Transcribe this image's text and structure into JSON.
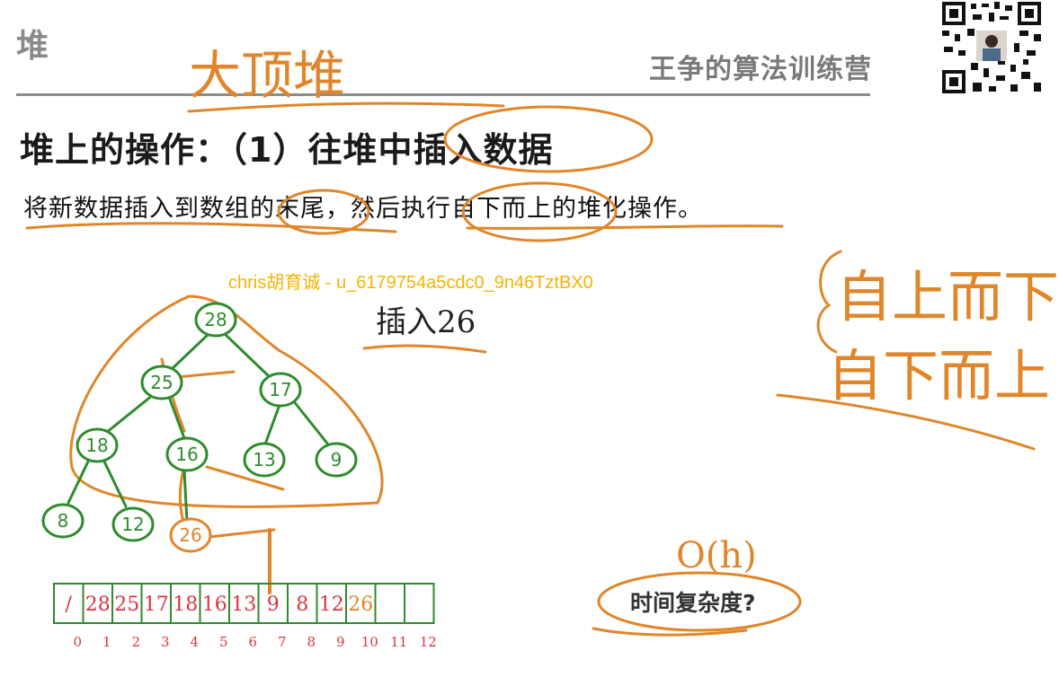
{
  "slide": {
    "corner_title": "堆",
    "brand": "王争的算法训练营",
    "heading": "堆上的操作：（1）往堆中插入数据",
    "description": "将新数据插入到数组的末尾，然后执行自下而上的堆化操作。",
    "watermark_user": "chris胡育诚 - u_6179754a5cdc0_9n46TztBX0",
    "bottom_question": "时间复杂度?"
  },
  "handwriting": {
    "top_note": "大顶堆",
    "insert_note": "插入26",
    "right_note_1": "自上而下",
    "right_note_2": "自下而上",
    "complexity_note": "O(h)"
  },
  "tree_nodes": [
    "28",
    "25",
    "17",
    "18",
    "16",
    "13",
    "9",
    "8",
    "12",
    "26"
  ],
  "array": {
    "cells": [
      "/",
      "28",
      "25",
      "17",
      "18",
      "16",
      "13",
      "9",
      "8",
      "12",
      "26",
      "",
      ""
    ],
    "indices": [
      "0",
      "1",
      "2",
      "3",
      "4",
      "5",
      "6",
      "7",
      "8",
      "9",
      "10",
      "11",
      "12"
    ]
  },
  "colors": {
    "ink_green": "#2e8b2e",
    "ink_orange": "#e0862a",
    "watermark_yellow": "#f5b300",
    "ink_red": "#d9363e"
  }
}
